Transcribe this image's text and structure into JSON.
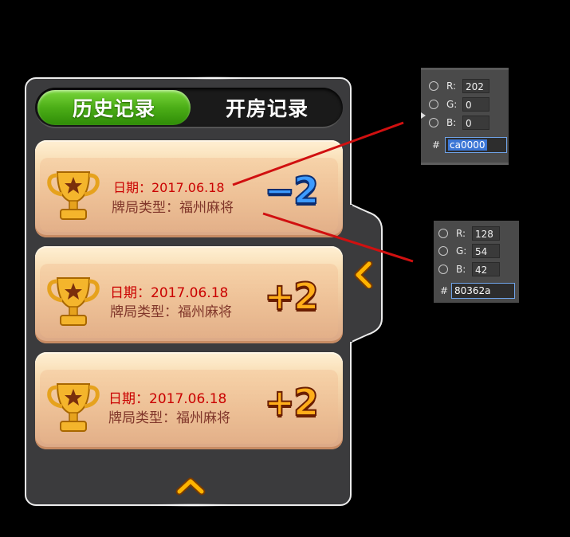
{
  "tabs": [
    {
      "label": "历史记录",
      "active": true
    },
    {
      "label": "开房记录",
      "active": false
    }
  ],
  "records": [
    {
      "date": "日期：2017.06.18",
      "game_type": "牌局类型：福州麻将",
      "score": "−2",
      "sign": "negative"
    },
    {
      "date": "日期：2017.06.18",
      "game_type": "牌局类型：福州麻将",
      "score": "+2",
      "sign": "positive"
    },
    {
      "date": "日期：2017.06.18",
      "game_type": "牌局类型：福州麻将",
      "score": "+2",
      "sign": "positive"
    }
  ],
  "icons": {
    "trophy": "trophy-icon",
    "collapse": "chevron-left-icon",
    "scroll_up": "chevron-up-icon"
  },
  "color_pickers": [
    {
      "r_label": "R:",
      "r_value": "202",
      "g_label": "G:",
      "g_value": "0",
      "b_label": "B:",
      "b_value": "0",
      "hash": "#",
      "hex": "ca0000"
    },
    {
      "r_label": "R:",
      "r_value": "128",
      "g_label": "G:",
      "g_value": "54",
      "b_label": "B:",
      "b_value": "42",
      "hash": "#",
      "hex": "80362a"
    }
  ],
  "colors": {
    "date_text": "#ca0000",
    "type_text": "#80362a",
    "active_tab": "#4cae17",
    "panel_bg": "#3b3b3d",
    "annotation_line": "#d01010"
  }
}
